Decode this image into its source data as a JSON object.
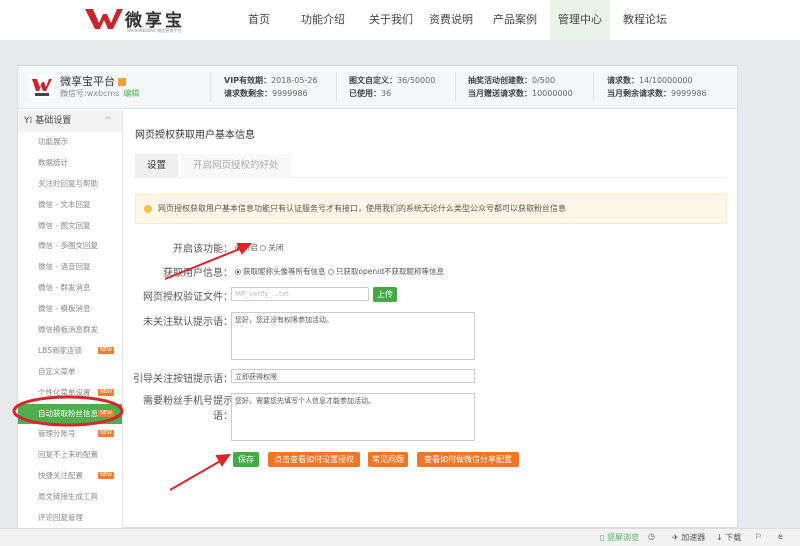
{
  "brand": {
    "name": "微享宝",
    "subtitle": "WAIXIANGBAO 微信营销平台",
    "logo_color": "#c4272c"
  },
  "nav": [
    {
      "label": "首页"
    },
    {
      "label": "功能介绍"
    },
    {
      "label": "关于我们"
    },
    {
      "label": "资费说明"
    },
    {
      "label": "产品案例"
    },
    {
      "label": "管理中心",
      "active": true
    },
    {
      "label": "教程论坛"
    }
  ],
  "account": {
    "name": "微享宝平台",
    "wechat_id": "微信号:wxbcms",
    "edit": "编辑"
  },
  "stats": {
    "vip_label": "VIP有效期：",
    "vip": "2018-05-26",
    "req_left_label": "请求数剩余：",
    "req_left": "9999986",
    "news_label": "图文自定义：",
    "news": "36/50000",
    "used_label": "已使用：",
    "used": "36",
    "lottery_label": "抽奖活动创建数：",
    "lottery": "0/500",
    "monthly_label": "当月赠送请求数：",
    "monthly": "10000000",
    "req_label": "请求数：",
    "req": "14/10000000",
    "month_left_label": "当月剩余请求数：",
    "month_left": "9999986"
  },
  "sidebar": {
    "section": "基础设置",
    "items": [
      {
        "label": "功能展示"
      },
      {
        "label": "数据统计"
      },
      {
        "label": "关注时回复与帮助"
      },
      {
        "label": "微信 - 文本回复"
      },
      {
        "label": "微信 - 图文回复"
      },
      {
        "label": "微信 - 多图文回复"
      },
      {
        "label": "微信 - 语音回复"
      },
      {
        "label": "微信 - 群发消息"
      },
      {
        "label": "微信 - 模板消息"
      },
      {
        "label": "微信模板消息群发"
      },
      {
        "label": "LBS商家连锁",
        "badge": "NEW"
      },
      {
        "label": "自定义菜单"
      },
      {
        "label": "个性化菜单设置",
        "badge": "NEW"
      },
      {
        "label": "自动获取粉丝信息",
        "badge": "NEW",
        "active": true
      },
      {
        "label": "管理分账号",
        "badge": "NEW"
      },
      {
        "label": "回复不上来的配置"
      },
      {
        "label": "快捷关注配置",
        "badge": "NEW"
      },
      {
        "label": "原文链接生成工具"
      },
      {
        "label": "评论回复管理"
      }
    ]
  },
  "main": {
    "title": "网页授权获取用户基本信息",
    "tabs": [
      {
        "label": "设置",
        "active": true
      },
      {
        "label": "开启网页授权的好处"
      }
    ],
    "tip": "网页授权获取用户基本信息功能只有认证服务号才有接口，使用我们的系统无论什么类型公众号都可以获取粉丝信息",
    "form": {
      "enable_label": "开启该功能：",
      "enable_on": "开启",
      "enable_off": "关闭",
      "info_label": "获取用户信息：",
      "info_opt1": "获取昵称头像等所有信息",
      "info_opt2": "只获取openid不获取昵称等信息",
      "file_label": "网页授权验证文件：",
      "file_value": "MP_verify_…txt",
      "upload": "上传",
      "unfollow_label": "未关注默认提示语：",
      "unfollow_value": "您好，您还没有权限参加活动。",
      "guide_label": "引导关注按钮提示语：",
      "guide_value": "立即获得权限",
      "phone_label": "需要粉丝手机号提示语：",
      "phone_value": "您好，需要您先填写个人信息才能参加活动。"
    },
    "buttons": {
      "save": "保存",
      "howto": "点击查看如何设置授权",
      "faq": "常见问题",
      "share": "查看如何做微信分享配置"
    }
  },
  "statusbar": {
    "view": "竖屏浏览",
    "accel": "加速器",
    "download": "下载"
  },
  "colors": {
    "green": "#47a847",
    "orange": "#f27425",
    "annotation": "#d9262b"
  }
}
